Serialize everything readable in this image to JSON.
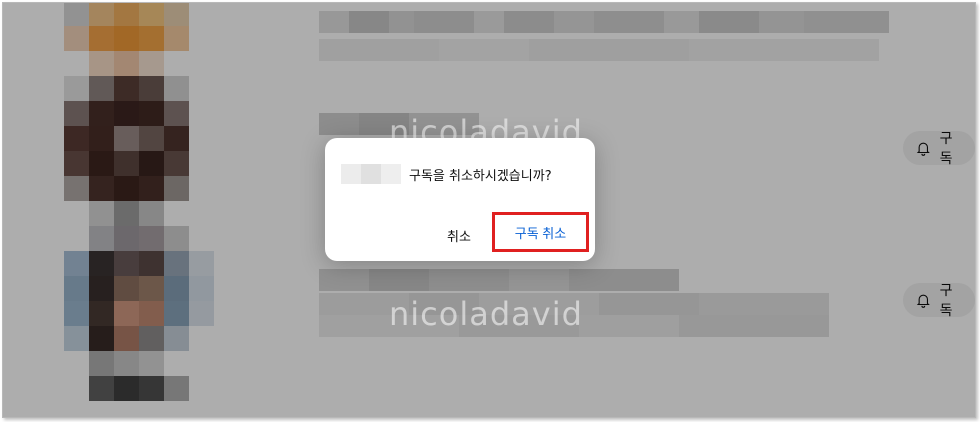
{
  "dialog": {
    "message": "구독을 취소하시겠습니까?",
    "cancel_label": "취소",
    "confirm_label": "구독 취소"
  },
  "subscribe_buttons": [
    {
      "label": "구독"
    },
    {
      "label": "구독"
    }
  ],
  "watermarks": [
    "nicoladavid",
    "nicoladavid"
  ],
  "colors": {
    "confirm_text": "#065fd4",
    "highlight_border": "#e02020",
    "overlay": "rgba(0,0,0,0.32)"
  },
  "icons": {
    "subscribe": "bell-icon"
  }
}
